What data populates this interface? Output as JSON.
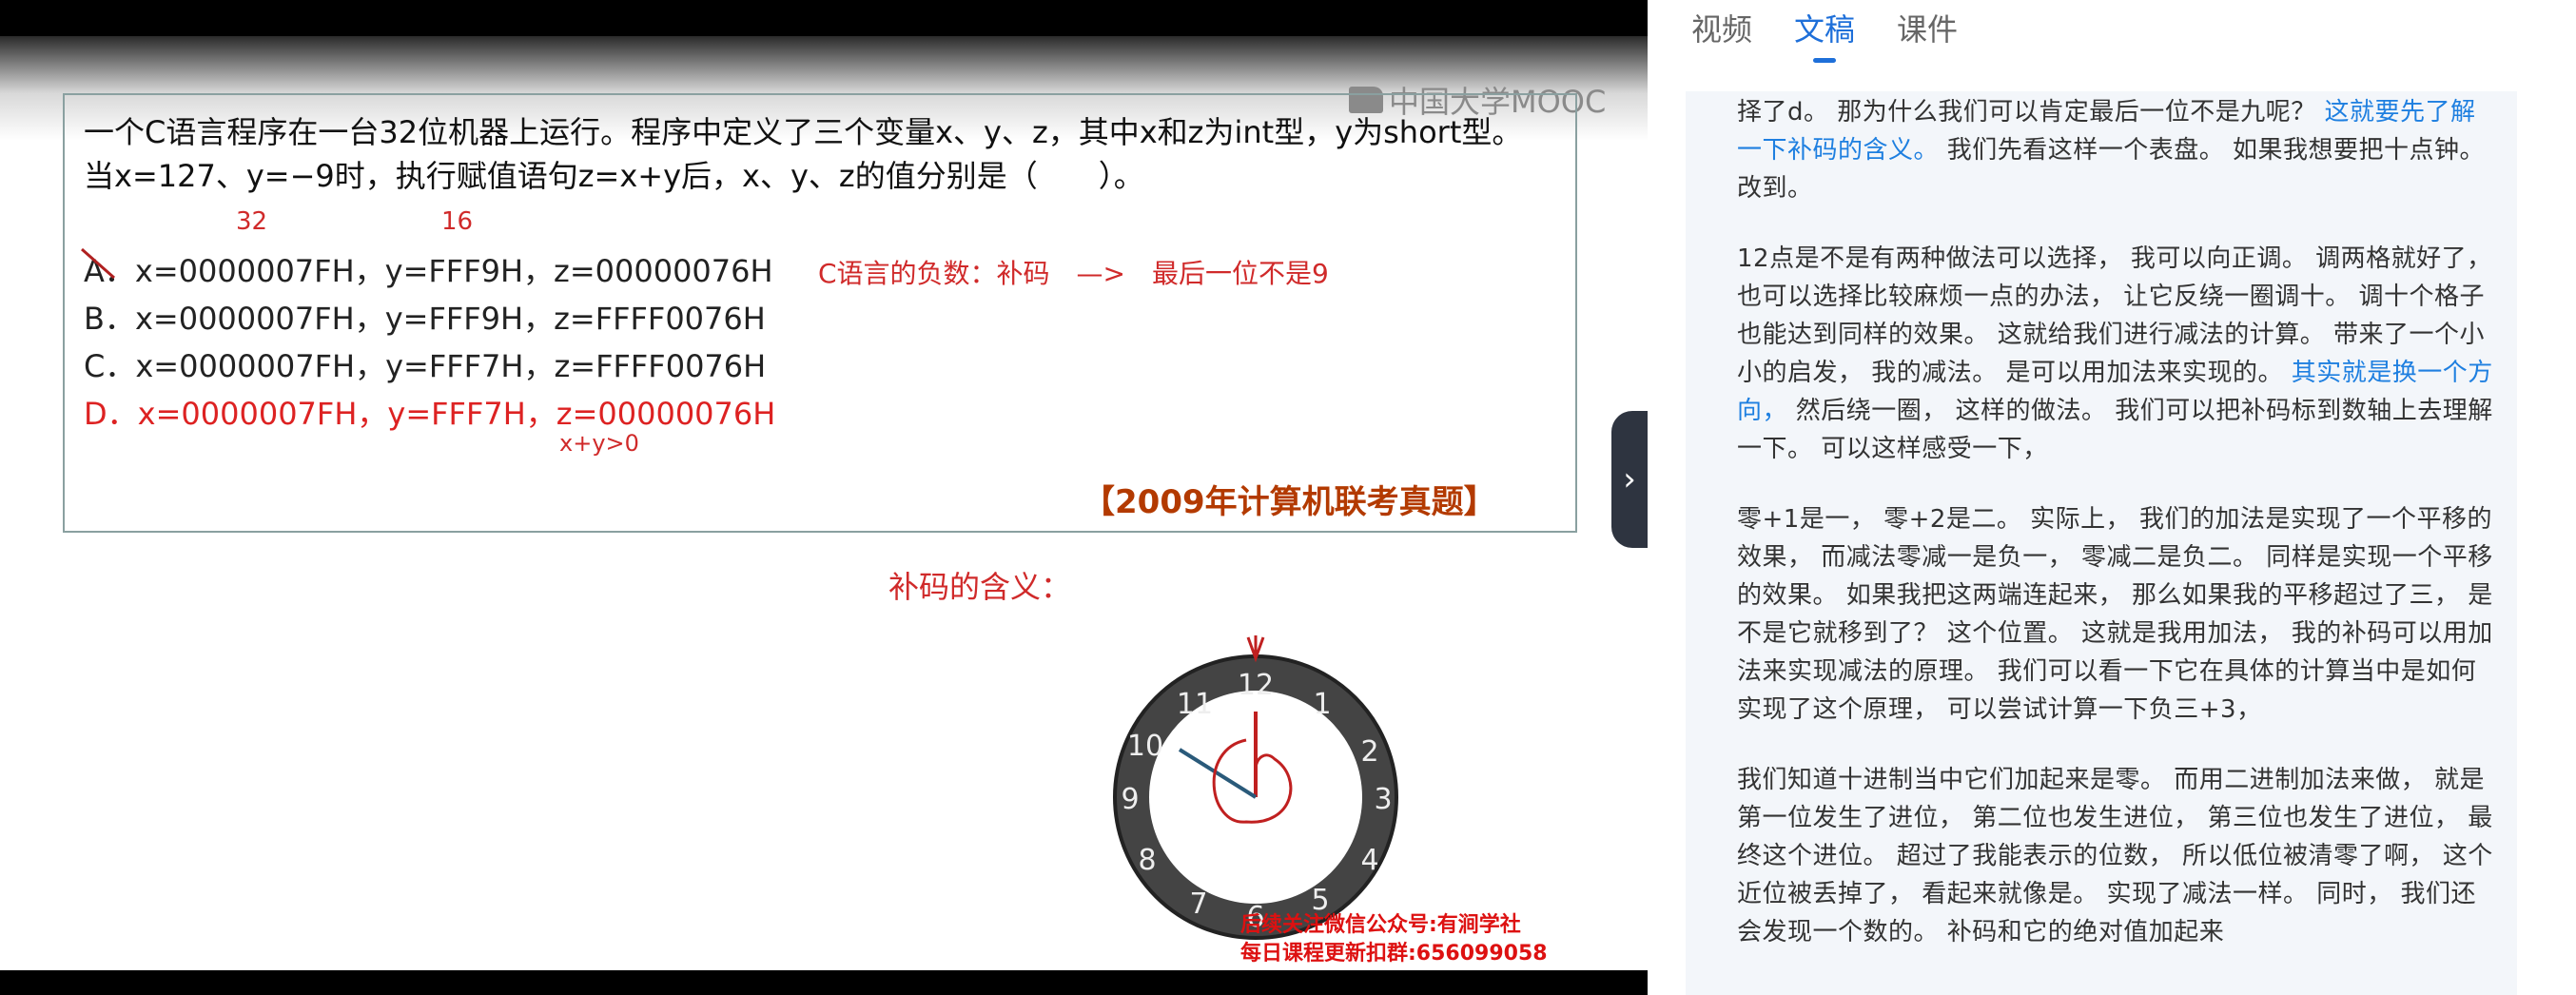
{
  "video": {
    "watermark": "中国大学MOOC",
    "question_line1": "一个C语言程序在一台32位机器上运行。程序中定义了三个变量x、y、z，其中x和z为int型，y为short型。",
    "question_line2": "当x=127、y=−9时，执行赋值语句z=x+y后，x、y、z的值分别是（　　）。",
    "annot_32": "32",
    "annot_16": "16",
    "options": [
      {
        "label": "A．x=0000007FH，y=FFF9H，z=00000076H"
      },
      {
        "label": "B．x=0000007FH，y=FFF9H，z=FFFF0076H"
      },
      {
        "label": "C．x=0000007FH，y=FFF7H，z=FFFF0076H"
      },
      {
        "label": "D．x=0000007FH，y=FFF7H，z=00000076H"
      }
    ],
    "annot_negative": "C语言的负数：补码　—>　最后一位不是9",
    "annot_xy": "x+y>0",
    "source": "【2009年计算机联考真题】",
    "bucode_label": "补码的含义：",
    "clock_numbers": [
      "12",
      "1",
      "2",
      "3",
      "4",
      "5",
      "6",
      "7",
      "8",
      "9",
      "10",
      "11"
    ],
    "footer_line1": "后续关注微信公众号:有涧学社",
    "footer_line2": "每日课程更新扣群:656099058",
    "colors": {
      "annotation": "#d02a2a",
      "answer": "#dd2222",
      "source": "#b33a00"
    }
  },
  "panel": {
    "tabs": [
      {
        "label": "视频",
        "active": false
      },
      {
        "label": "文稿",
        "active": true
      },
      {
        "label": "课件",
        "active": false
      }
    ],
    "accent": "#1e6fd9",
    "p1_a": "择了d。 那为什么我们可以肯定最后一位不是九呢？ ",
    "p1_hl": "这就要先了解一下补码的含义。",
    "p1_b": " 我们先看这样一个表盘。 如果我想要把十点钟。 改到。",
    "p2_a": "12点是不是有两种做法可以选择， 我可以向正调。 调两格就好了， 也可以选择比较麻烦一点的办法， 让它反绕一圈调十。 调十个格子也能达到同样的效果。 这就给我们进行减法的计算。 带来了一个小小的启发， 我的减法。 是可以用加法来实现的。 ",
    "p2_hl": "其实就是换一个方向，",
    "p2_b": " 然后绕一圈， 这样的做法。 我们可以把补码标到数轴上去理解一下。 可以这样感受一下，",
    "p3": "零+1是一， 零+2是二。 实际上， 我们的加法是实现了一个平移的效果， 而减法零减一是负一， 零减二是负二。 同样是实现一个平移的效果。 如果我把这两端连起来， 那么如果我的平移超过了三， 是不是它就移到了？ 这个位置。 这就是我用加法， 我的补码可以用加法来实现减法的原理。 我们可以看一下它在具体的计算当中是如何实现了这个原理， 可以尝试计算一下负三+3，",
    "p4": "我们知道十进制当中它们加起来是零。 而用二进制加法来做， 就是第一位发生了进位， 第二位也发生进位， 第三位也发生了进位， 最终这个进位。 超过了我能表示的位数， 所以低位被清零了啊， 这个近位被丢掉了， 看起来就像是。 实现了减法一样。 同时， 我们还会发现一个数的。 补码和它的绝对值加起来"
  }
}
